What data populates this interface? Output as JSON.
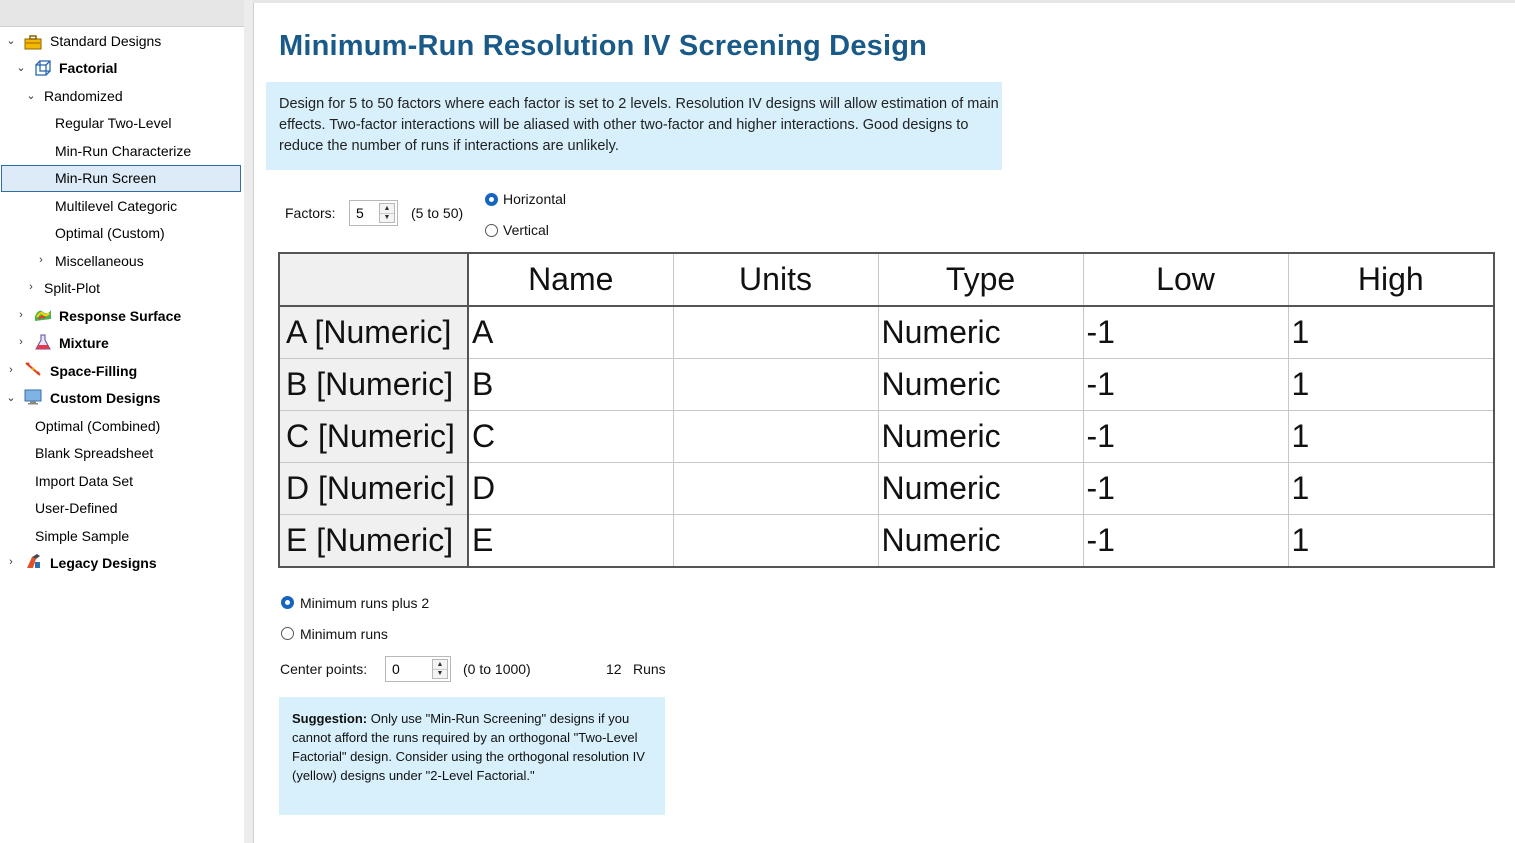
{
  "sidebar": {
    "items": [
      {
        "label": "Standard Designs",
        "icon": "toolbox-icon"
      },
      {
        "label": "Factorial",
        "icon": "factorial-cube-icon"
      },
      {
        "label": "Randomized"
      },
      {
        "label": "Regular Two-Level"
      },
      {
        "label": "Min-Run Characterize"
      },
      {
        "label": "Min-Run Screen",
        "selected": true
      },
      {
        "label": "Multilevel Categoric"
      },
      {
        "label": "Optimal (Custom)"
      },
      {
        "label": "Miscellaneous"
      },
      {
        "label": "Split-Plot"
      },
      {
        "label": "Response Surface",
        "icon": "response-surface-icon"
      },
      {
        "label": "Mixture",
        "icon": "flask-icon"
      },
      {
        "label": "Space-Filling",
        "icon": "space-filling-icon"
      },
      {
        "label": "Custom Designs",
        "icon": "monitor-icon"
      },
      {
        "label": "Optimal (Combined)"
      },
      {
        "label": "Blank Spreadsheet"
      },
      {
        "label": "Import Data Set"
      },
      {
        "label": "User-Defined"
      },
      {
        "label": "Simple Sample"
      },
      {
        "label": "Legacy Designs",
        "icon": "legacy-icon"
      }
    ]
  },
  "main": {
    "title": "Minimum-Run Resolution IV Screening Design",
    "description": "Design for 5 to 50 factors where each factor is set to 2 levels. Resolution IV designs will allow estimation of main effects. Two-factor interactions will be aliased with other two-factor and higher interactions. Good designs to reduce the number of runs if interactions are unlikely.",
    "factors": {
      "label": "Factors:",
      "value": "5",
      "range": "(5 to 50)"
    },
    "orientation": {
      "horizontal": "Horizontal",
      "vertical": "Vertical",
      "selected": "Horizontal"
    },
    "table": {
      "columns": [
        "Name",
        "Units",
        "Type",
        "Low",
        "High"
      ],
      "rows": [
        {
          "header": "A [Numeric]",
          "name": "A",
          "units": "",
          "type": "Numeric",
          "low": "-1",
          "high": "1"
        },
        {
          "header": "B [Numeric]",
          "name": "B",
          "units": "",
          "type": "Numeric",
          "low": "-1",
          "high": "1"
        },
        {
          "header": "C [Numeric]",
          "name": "C",
          "units": "",
          "type": "Numeric",
          "low": "-1",
          "high": "1"
        },
        {
          "header": "D [Numeric]",
          "name": "D",
          "units": "",
          "type": "Numeric",
          "low": "-1",
          "high": "1"
        },
        {
          "header": "E [Numeric]",
          "name": "E",
          "units": "",
          "type": "Numeric",
          "low": "-1",
          "high": "1"
        }
      ]
    },
    "runs_option": {
      "plus2": "Minimum runs plus 2",
      "minimum": "Minimum runs",
      "selected": "plus2"
    },
    "center_points": {
      "label": "Center points:",
      "value": "0",
      "range": "(0 to 1000)"
    },
    "runs": {
      "count": "12",
      "label": "Runs"
    },
    "suggestion": {
      "bold": "Suggestion:",
      "text": " Only use \"Min-Run Screening\" designs if you cannot afford the runs required by an orthogonal \"Two-Level Factorial\" design. Consider using the orthogonal resolution IV (yellow) designs under \"2-Level Factorial.\""
    }
  },
  "colors": {
    "title": "#1a5a88",
    "info_box": "#d7f0fb",
    "selection": "#dcebf7",
    "radio_on": "#1565c0"
  }
}
